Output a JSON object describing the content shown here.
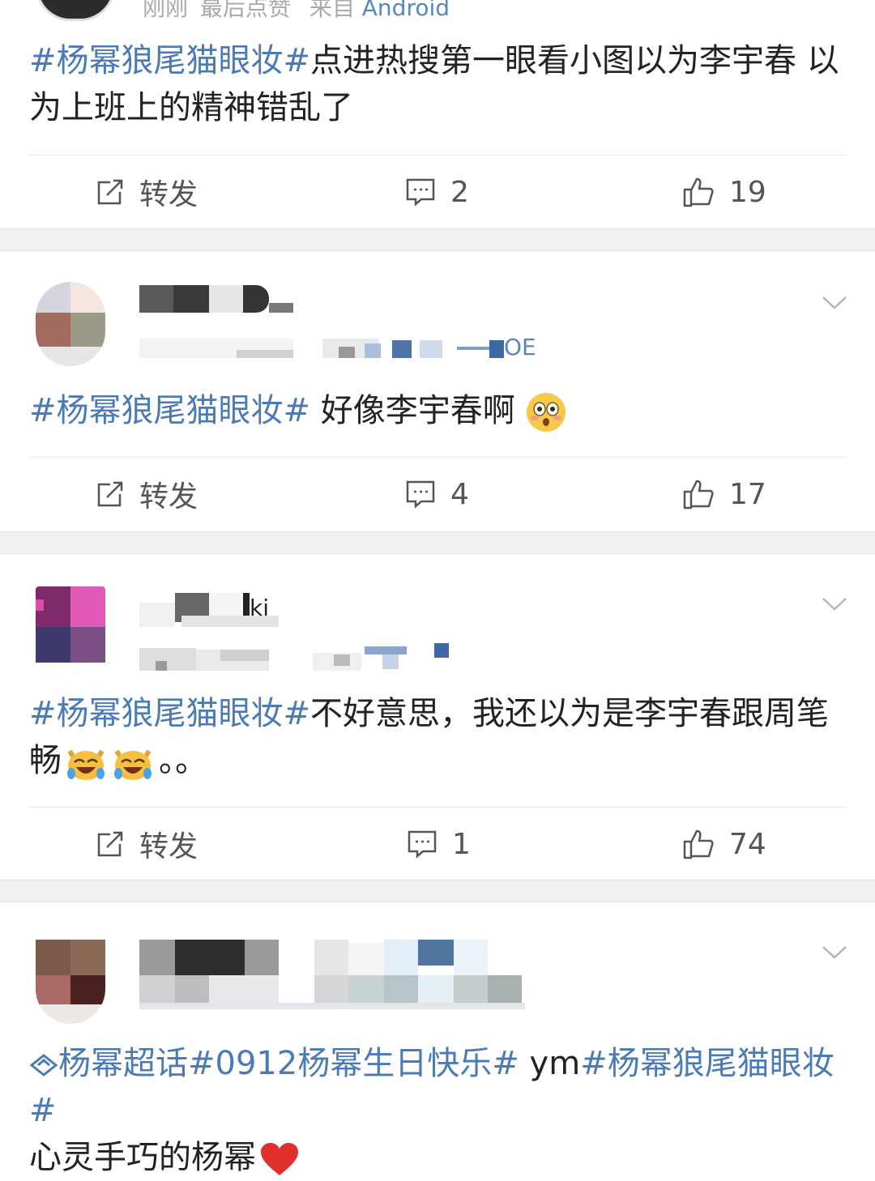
{
  "post1": {
    "meta_time": "刚刚",
    "meta_sep": "最后点赞",
    "meta_from": "来自",
    "meta_device": "Android",
    "tag": "#杨幂狼尾猫眼妆#",
    "text": "点进热搜第一眼看小图以为李宇春 以为上班上的精神错乱了",
    "repost_label": "转发",
    "comments": "2",
    "likes": "19"
  },
  "post2": {
    "tag": "#杨幂狼尾猫眼妆#",
    "text": " 好像李宇春啊",
    "emoji": "flushed-face-emoji",
    "repost_label": "转发",
    "comments": "4",
    "likes": "17"
  },
  "post3": {
    "tag": "#杨幂狼尾猫眼妆#",
    "text": "不好意思，我还以为是李宇春跟周笔畅",
    "trail": "。。",
    "emoji": "crying-laughing-cat-emoji",
    "repost_label": "转发",
    "comments": "1",
    "likes": "74"
  },
  "post4": {
    "super_topic": "杨幂超话",
    "tag1": "#0912杨幂生日快乐#",
    "mid": " ym",
    "tag2": "#杨幂狼尾猫眼妆#",
    "text": "心灵手巧的杨幂",
    "emoji": "red-heart-emoji"
  },
  "colors": {
    "tag": "#4a7bb7",
    "gap": "#f0f0f0",
    "icon": "#555555"
  }
}
